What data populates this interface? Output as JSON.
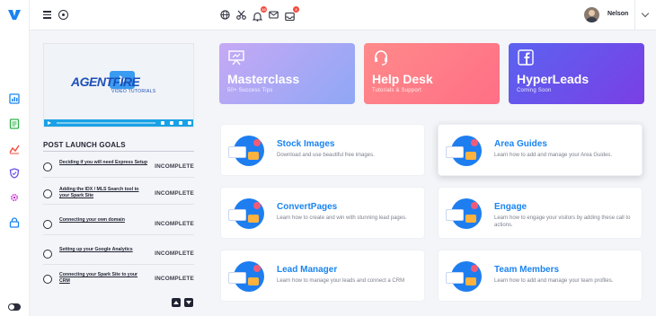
{
  "app": {
    "name": "Agent Fire"
  },
  "colors": {
    "accent": "#1a84f0",
    "badge": "#f24c3d",
    "masterclass": "#b0a8f5",
    "helpdesk": "#ff7a88",
    "hyperleads": "#6a4fea"
  },
  "panel": {
    "video": {
      "brand": "AGENTFIRE",
      "subtitle": "VIDEO TUTORIALS"
    },
    "goals_title": "POST LAUNCH GOALS",
    "goals": [
      {
        "text": "Deciding if you will need Express Setup",
        "status": "INCOMPLETE"
      },
      {
        "text": "Adding the IDX / MLS Search tool to your Spark Site",
        "status": "INCOMPLETE"
      },
      {
        "text": "Connecting your own domain",
        "status": "INCOMPLETE"
      },
      {
        "text": "Setting up your Google Analytics",
        "status": "INCOMPLETE"
      },
      {
        "text": "Connecting your Spark Site to your CRM",
        "status": "INCOMPLETE"
      }
    ]
  },
  "topbar": {
    "icons": [
      "globe-icon",
      "scissors-icon",
      "bell-icon",
      "mail-icon",
      "inbox-icon"
    ],
    "bell_badge": "10",
    "inbox_badge": "2",
    "user_name": "Nelson"
  },
  "hero": [
    {
      "title": "Masterclass",
      "subtitle": "50+ Success Tips"
    },
    {
      "title": "Help Desk",
      "subtitle": "Tutorials & Support"
    },
    {
      "title": "HyperLeads",
      "subtitle": "Coming Soon"
    }
  ],
  "cards": [
    {
      "title": "Stock Images",
      "desc": "Download and use beautiful free images."
    },
    {
      "title": "Area Guides",
      "desc": "Learn how to add and manage your Area Guides."
    },
    {
      "title": "ConvertPages",
      "desc": "Learn how to create and win with stunning lead pages."
    },
    {
      "title": "Engage",
      "desc": "Learn how to engage your visitors by adding these call to actions."
    },
    {
      "title": "Lead Manager",
      "desc": "Learn how to manage your leads and connect a CRM"
    },
    {
      "title": "Team Members",
      "desc": "Learn how to add and manage your team profiles."
    }
  ]
}
